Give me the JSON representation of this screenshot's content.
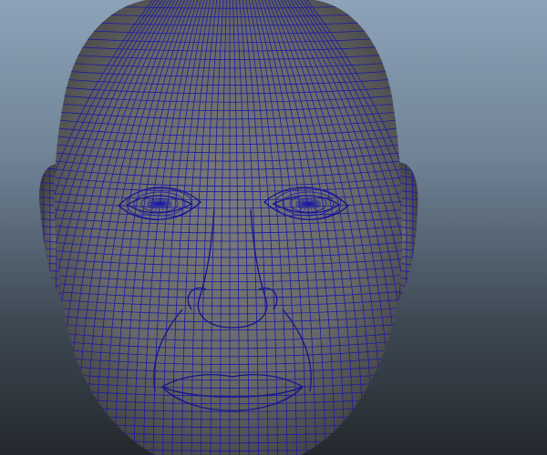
{
  "viewport": {
    "background_top_color": "#8ea3b8",
    "background_bottom_color": "#23282d",
    "mesh_fill_color": "#6e6e6e",
    "wireframe_color": "#1a1aa8"
  },
  "model": {
    "subject": "head-mesh",
    "display_mode": "wireframe-on-shaded"
  }
}
